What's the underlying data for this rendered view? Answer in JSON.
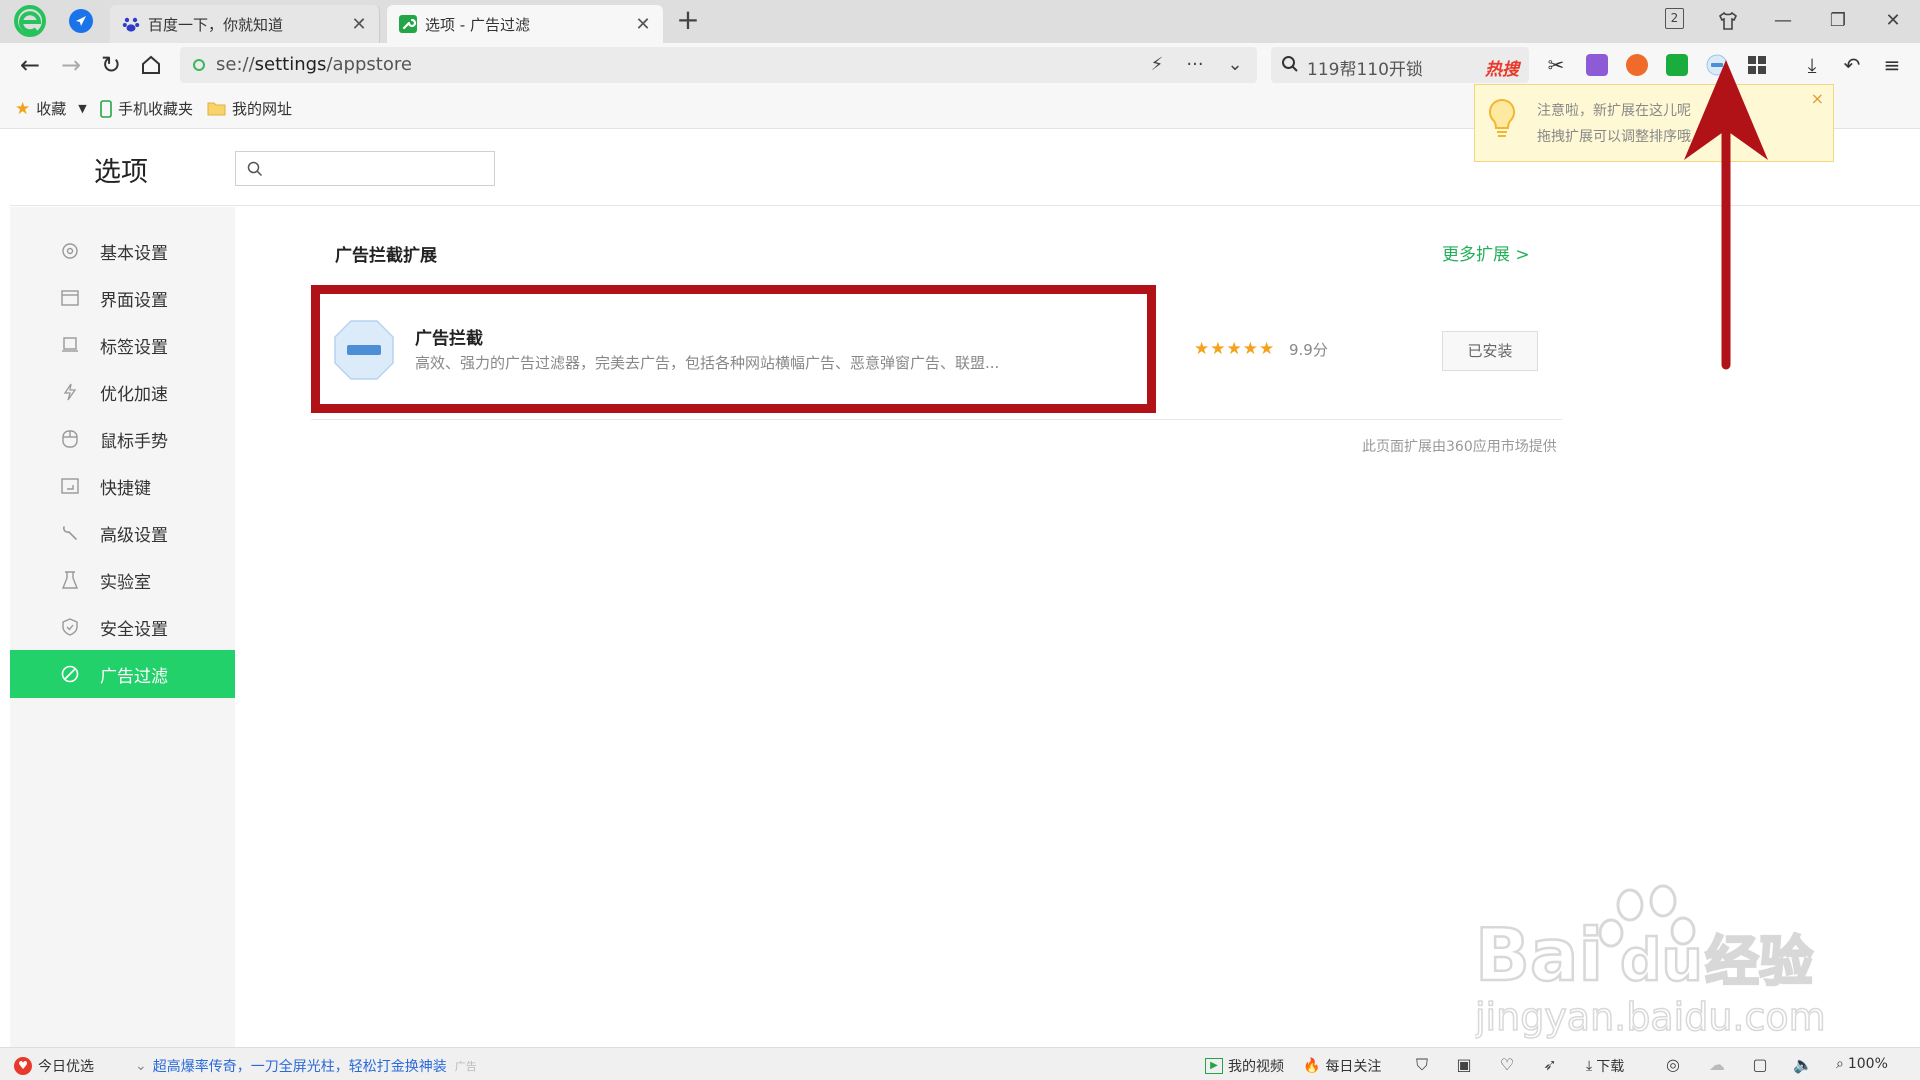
{
  "tabs": [
    {
      "title": "百度一下，你就知道"
    },
    {
      "title": "选项 - 广告过滤"
    }
  ],
  "tab_count": "2",
  "address": {
    "scheme": "se://",
    "host": "settings",
    "path": "/appstore"
  },
  "search": {
    "query": "119帮110开锁",
    "hot_label": "热搜"
  },
  "bookmarks": [
    {
      "label": "收藏"
    },
    {
      "label": "手机收藏夹"
    },
    {
      "label": "我的网址"
    }
  ],
  "tooltip": {
    "line1": "注意啦，新扩展在这儿呢",
    "line2": "拖拽扩展可以调整排序哦",
    "close": "×"
  },
  "settings": {
    "title": "选项",
    "search_value": ""
  },
  "sidebar": {
    "items": [
      {
        "label": "基本设置"
      },
      {
        "label": "界面设置"
      },
      {
        "label": "标签设置"
      },
      {
        "label": "优化加速"
      },
      {
        "label": "鼠标手势"
      },
      {
        "label": "快捷键"
      },
      {
        "label": "高级设置"
      },
      {
        "label": "实验室"
      },
      {
        "label": "安全设置"
      },
      {
        "label": "广告过滤"
      }
    ],
    "active_index": 9
  },
  "content": {
    "section_title": "广告拦截扩展",
    "more_link": "更多扩展 >",
    "extension": {
      "name": "广告拦截",
      "description": "高效、强力的广告过滤器，完美去广告，包括各种网站横幅广告、恶意弹窗广告、联盟...",
      "stars": "★★★★★",
      "rating": 5,
      "score": "9.9分",
      "button": "已安装"
    },
    "provider_note": "此页面扩展由360应用市场提供"
  },
  "statusbar": {
    "left": "今日优选",
    "promo": "超高爆率传奇，一刀全屏光柱，轻松打金换神装",
    "ad": "广告",
    "video": "我的视频",
    "daily": "每日关注",
    "download": "下载",
    "zoom": "100%"
  },
  "colors": {
    "accent": "#23d16a",
    "highlight_box": "#b11217",
    "arrow": "#b11217",
    "link": "#23b05a",
    "star": "#f5a21b"
  }
}
